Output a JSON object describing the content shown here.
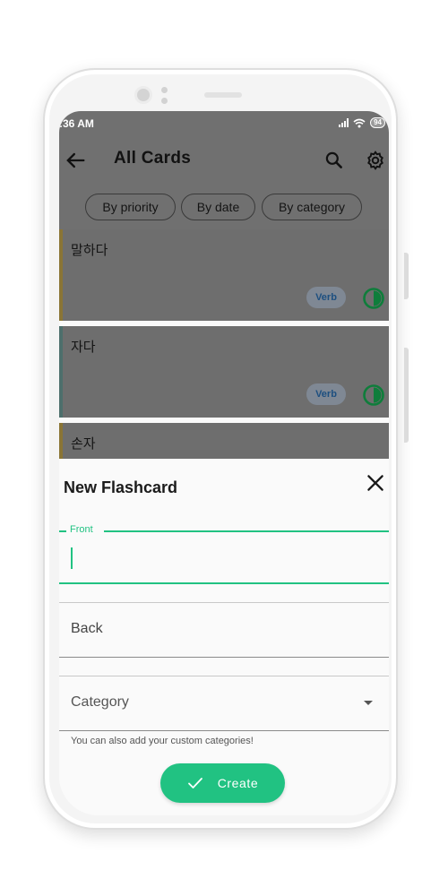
{
  "status_bar": {
    "time": ":36 AM",
    "battery": "94"
  },
  "app_bar": {
    "title": "All Cards",
    "back_icon": "arrow-left-icon",
    "search_icon": "search-icon",
    "settings_icon": "gear-icon"
  },
  "sort_chips": [
    {
      "label": "By priority"
    },
    {
      "label": "By date"
    },
    {
      "label": "By category"
    }
  ],
  "cards": [
    {
      "front": "말하다",
      "category": "Verb",
      "progress": 0.5
    },
    {
      "front": "자다",
      "category": "Verb",
      "progress": 0.5
    },
    {
      "front": "손자"
    }
  ],
  "sheet": {
    "title": "New Flashcard",
    "front_label": "Front",
    "front_value": "",
    "back_label": "Back",
    "category_label": "Category",
    "helper_text": "You can also add your custom categories!",
    "create_label": "Create"
  },
  "colors": {
    "accent": "#21c282",
    "scrim": "#707070",
    "badge_text": "#1d4f80"
  }
}
